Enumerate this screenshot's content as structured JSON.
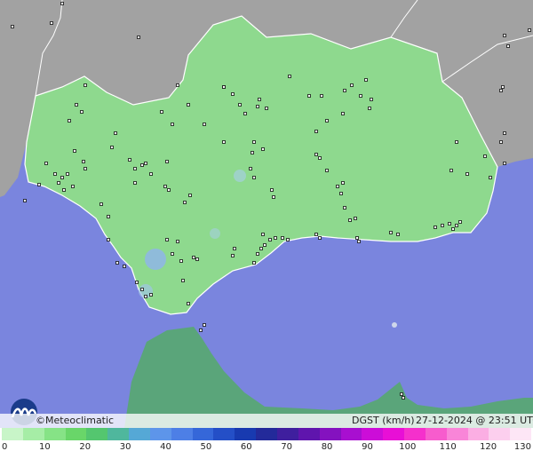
{
  "map": {
    "region": "Andalucía",
    "station_marker_icon": "station-dot-icon"
  },
  "info_bar": {
    "copyright": "©Meteoclimatic",
    "variable": "DGST (km/h)",
    "timestamp": "27-12-2024 @ 23:51 UTC"
  },
  "logo": {
    "icon": "meteoclimatic-logo-icon"
  },
  "legend": {
    "ticks": [
      "0",
      "10",
      "20",
      "30",
      "40",
      "50",
      "60",
      "70",
      "80",
      "90",
      "100",
      "110",
      "120",
      "130"
    ],
    "colors": [
      "#c8f5c8",
      "#a6eda6",
      "#86e386",
      "#69d669",
      "#54c66f",
      "#4fb79d",
      "#55a8d6",
      "#5d95ea",
      "#4d7fe6",
      "#3567d9",
      "#244fc7",
      "#183ab0",
      "#232a9a",
      "#3f1f9e",
      "#5f15ad",
      "#8412bf",
      "#a80fd0",
      "#cc0dd8",
      "#e80fd6",
      "#f530cc",
      "#f75ccd",
      "#f985d8",
      "#fbaee3",
      "#fccfee",
      "#fde6f6"
    ]
  },
  "colors": {
    "sea": "#7a85de",
    "land_neutral": "#a2a2a2",
    "land_andalucia": "#8ed98e",
    "border": "#ffffff"
  }
}
